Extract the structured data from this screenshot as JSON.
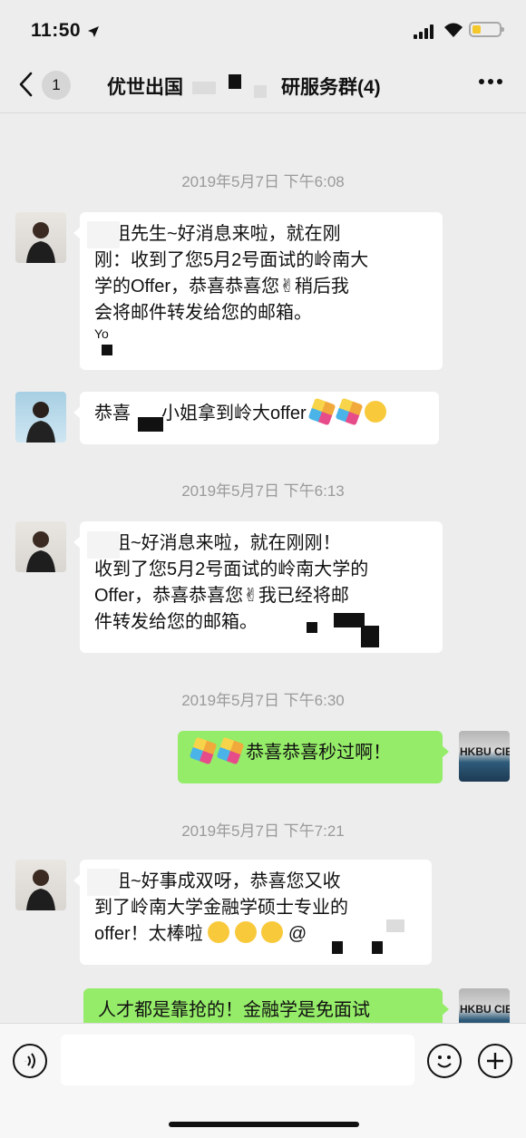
{
  "status": {
    "time": "11:50",
    "location_icon": "location-arrow-icon"
  },
  "nav": {
    "back_badge": "1",
    "title_prefix": "优世出国",
    "title_suffix": "研服务群(4)",
    "more_icon": "more-dots-icon"
  },
  "messages": [
    {
      "timestamp": "2019年5月7日 下午6:08"
    },
    {
      "sender": "consultant-a",
      "side": "left",
      "lines": [
        "小姐先生~好消息来啦，就在刚",
        "刚：收到了您5月2号面试的岭南大",
        "学的Offer，恭喜恭喜您✌稍后我",
        "会将邮件转发给您的邮箱。",
        "Yo"
      ]
    },
    {
      "sender": "consultant-b",
      "side": "left",
      "lines": [
        "恭喜",
        "小姐拿到岭大offer"
      ]
    },
    {
      "timestamp": "2019年5月7日 下午6:13"
    },
    {
      "sender": "consultant-a",
      "side": "left",
      "lines": [
        "小姐~好消息来啦，就在刚刚！",
        "收到了您5月2号面试的岭南大学的",
        "Offer，恭喜恭喜您✌我已经将邮",
        "件转发给您的邮箱。"
      ]
    },
    {
      "timestamp": "2019年5月7日 下午6:30"
    },
    {
      "sender": "me",
      "side": "right",
      "lines": [
        "恭喜恭喜秒过啊！"
      ]
    },
    {
      "timestamp": "2019年5月7日 下午7:21"
    },
    {
      "sender": "consultant-a",
      "side": "left",
      "lines": [
        "小姐~好事成双呀，恭喜您又收",
        "到了岭南大学金融学硕士专业的",
        "offer！太棒啦",
        "@"
      ]
    },
    {
      "sender": "me",
      "side": "right",
      "lines": [
        "人才都是靠抢的！金融学是免面试"
      ]
    }
  ],
  "avatars": {
    "me_caption": "HKBU CIE"
  },
  "colors": {
    "background": "#ededed",
    "my_bubble": "#95ec69",
    "their_bubble": "#ffffff"
  }
}
